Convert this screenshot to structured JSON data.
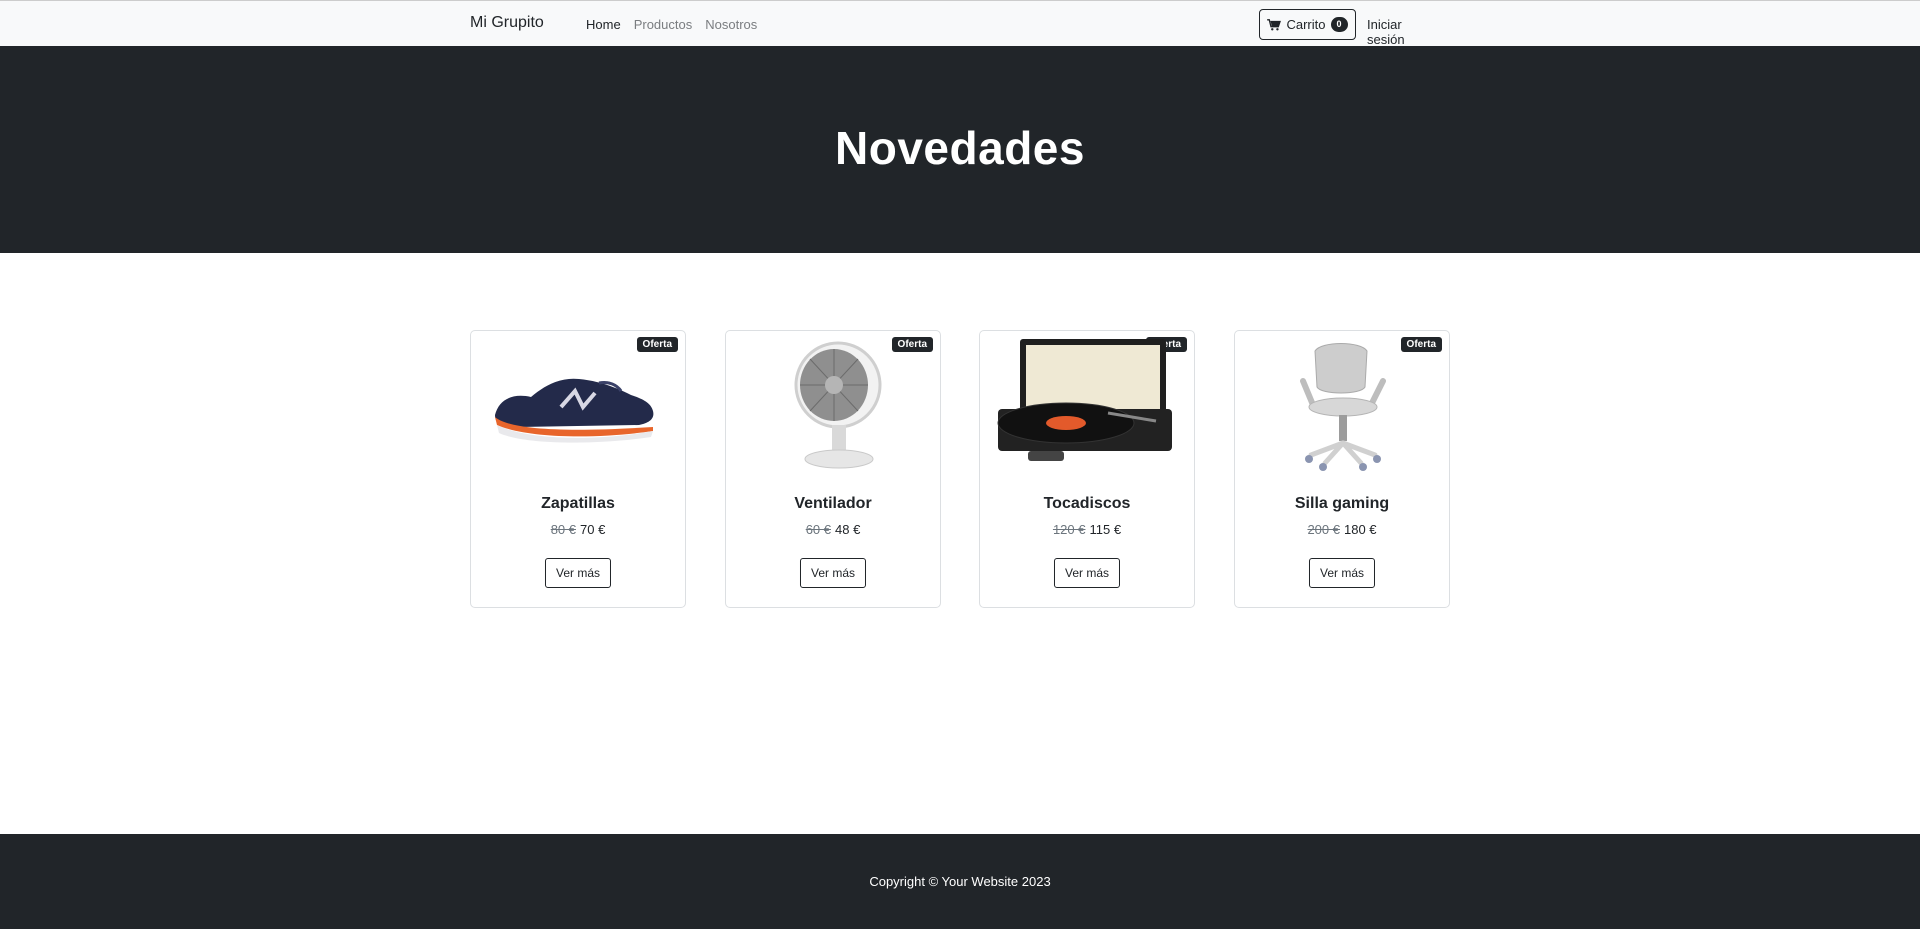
{
  "navbar": {
    "brand": "Mi Grupito",
    "links": [
      {
        "label": "Home",
        "active": true
      },
      {
        "label": "Productos",
        "active": false
      },
      {
        "label": "Nosotros",
        "active": false
      }
    ],
    "cart_label": "Carrito",
    "cart_count": "0",
    "login_label": "Iniciar sesión"
  },
  "hero": {
    "title": "Novedades"
  },
  "products": [
    {
      "name": "Zapatillas",
      "old_price": "80 €",
      "price": "70 €",
      "badge": "Oferta",
      "button": "Ver más",
      "icon": "sneaker-image"
    },
    {
      "name": "Ventilador",
      "old_price": "60 €",
      "price": "48 €",
      "badge": "Oferta",
      "button": "Ver más",
      "icon": "fan-image"
    },
    {
      "name": "Tocadiscos",
      "old_price": "120 €",
      "price": "115 €",
      "badge": "Oferta",
      "button": "Ver más",
      "icon": "turntable-image"
    },
    {
      "name": "Silla gaming",
      "old_price": "200 €",
      "price": "180 €",
      "badge": "Oferta",
      "button": "Ver más",
      "icon": "office-chair-image"
    }
  ],
  "footer": {
    "copyright": "Copyright © Your Website 2023"
  },
  "colors": {
    "dark": "#212529",
    "light": "#f8f9fa",
    "accent_orange": "#e8652b"
  }
}
